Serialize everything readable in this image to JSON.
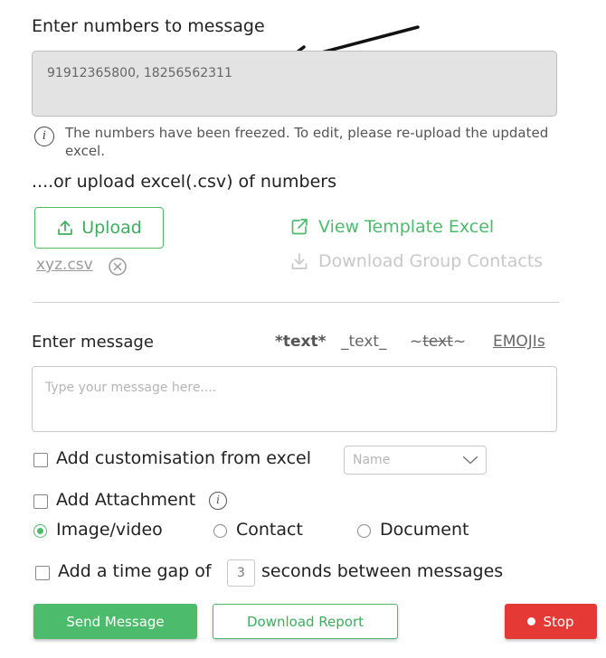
{
  "numbers_section": {
    "title": "Enter numbers to message",
    "numbers_value": "91912365800, 18256562311",
    "freeze_note": "The numbers have been freezed. To edit, please re-upload the updated excel."
  },
  "upload_section": {
    "heading": "....or upload excel(.csv) of numbers",
    "upload_label": "Upload",
    "file_name": "xyz.csv",
    "view_template_label": "View Template Excel",
    "download_contacts_label": "Download Group Contacts"
  },
  "message_section": {
    "label": "Enter message",
    "format_bold": "*text*",
    "format_italic": "_text_",
    "format_strike_prefix": "~",
    "format_strike_text": "text",
    "format_strike_suffix": "~",
    "emojis_label": "EMOJIs",
    "placeholder": "Type your message here...."
  },
  "options": {
    "customisation_label": "Add customisation from excel",
    "customisation_select_placeholder": "Name",
    "attachment_label": "Add Attachment",
    "attachment_types": [
      {
        "label": "Image/video",
        "selected": true
      },
      {
        "label": "Contact",
        "selected": false
      },
      {
        "label": "Document",
        "selected": false
      }
    ],
    "time_gap_prefix": "Add a time gap of",
    "time_gap_value": "3",
    "time_gap_suffix": "seconds between messages"
  },
  "actions": {
    "send_label": "Send Message",
    "report_label": "Download Report",
    "stop_label": "Stop"
  },
  "colors": {
    "accent_green": "#4cbb6c",
    "stop_red": "#e53935",
    "disabled_gray": "#c8c8c8"
  }
}
